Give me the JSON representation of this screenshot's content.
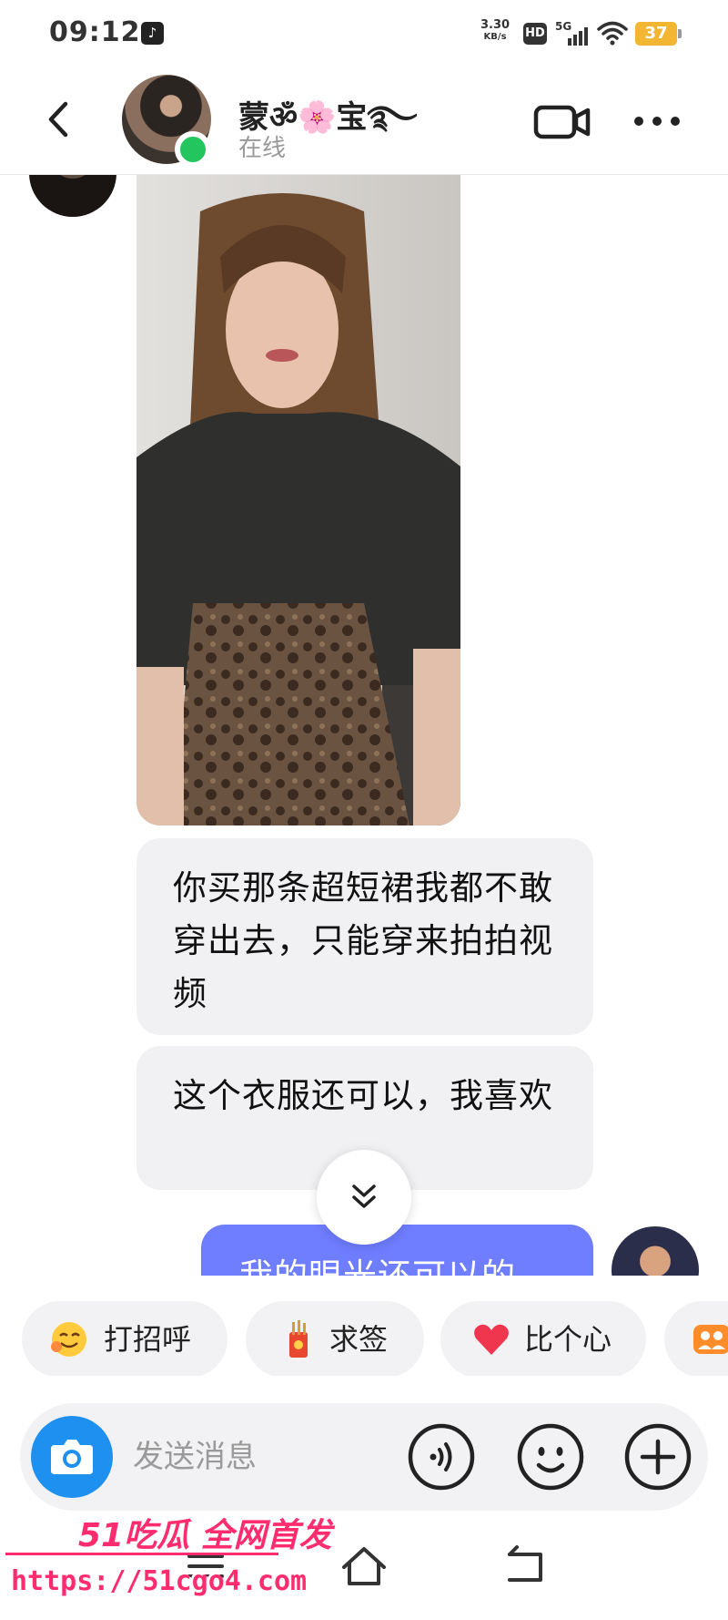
{
  "status_bar": {
    "time": "09:12",
    "net_speed_value": "3.30",
    "net_speed_unit": "KB/s",
    "hd_label": "HD",
    "signal_label": "5G",
    "battery": "37"
  },
  "header": {
    "contact_name": "蒙ॐ🌸宝࿐",
    "status": "在线"
  },
  "messages": [
    {
      "type": "image",
      "from": "peer"
    },
    {
      "type": "text",
      "from": "peer",
      "text": "你买那条超短裙我都不敢穿出去，只能穿来拍拍视频"
    },
    {
      "type": "text",
      "from": "peer",
      "text": "这个衣服还可以，我喜欢"
    },
    {
      "type": "text",
      "from": "me",
      "text": "我的眼光还可以的"
    }
  ],
  "quick_replies": [
    {
      "label": "打招呼",
      "icon": "smile-wave-emoji"
    },
    {
      "label": "求签",
      "icon": "fortune-sticks-icon"
    },
    {
      "label": "比个心",
      "icon": "heart-icon"
    },
    {
      "label": "",
      "icon": "group-photo-icon"
    }
  ],
  "input": {
    "placeholder": "发送消息"
  },
  "watermark": {
    "line1": "51吃瓜 全网首发",
    "line2": "https://51cgo4.com"
  },
  "colors": {
    "my_bubble": "#6f7dff",
    "peer_bubble": "#f1f1f3",
    "online": "#22c55e",
    "camera_button": "#1e90ef",
    "watermark": "#ff2d6f"
  }
}
